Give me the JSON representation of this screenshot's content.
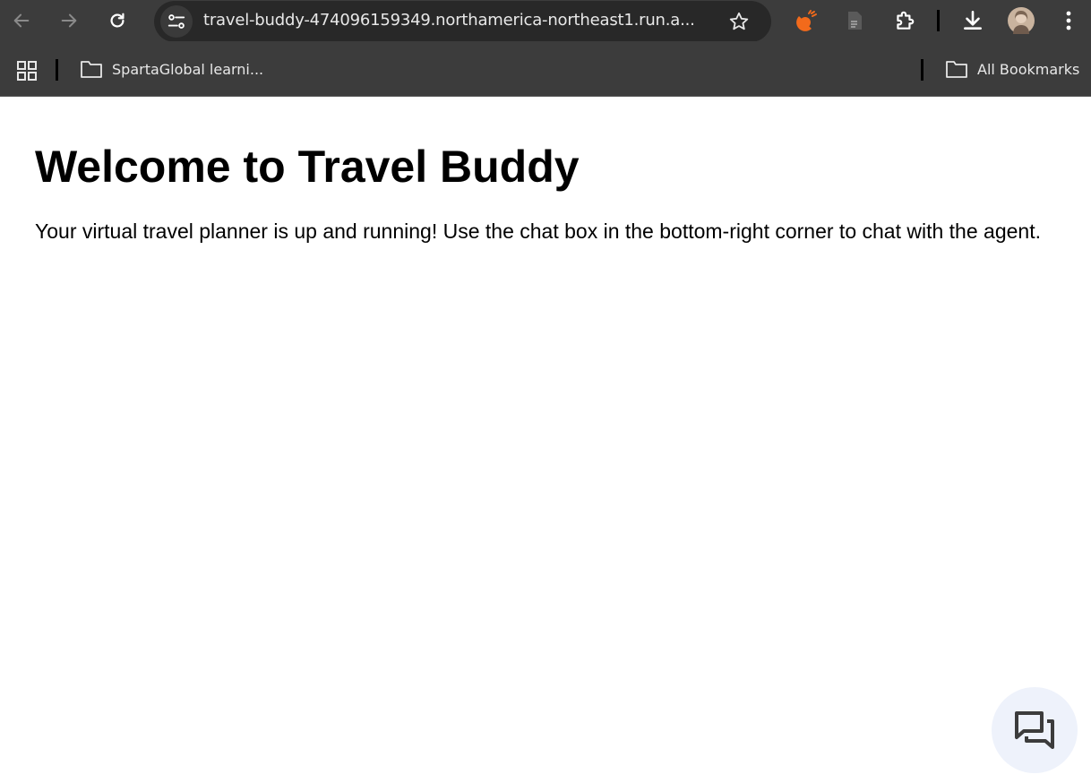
{
  "browser": {
    "url": "travel-buddy-474096159349.northamerica-northeast1.run.a...",
    "toolbar_icons": [
      "back-arrow-icon",
      "forward-arrow-icon",
      "reload-icon",
      "site-info-icon",
      "star-icon",
      "extension-orange-icon",
      "document-icon",
      "puzzle-icon",
      "download-icon",
      "profile-avatar",
      "kebab-menu-icon"
    ],
    "accent_color": "#f26a1b"
  },
  "bookmarks": {
    "folder": "SpartaGlobal learni...",
    "all_bookmarks": "All Bookmarks"
  },
  "page": {
    "title": "Welcome to Travel Buddy",
    "body": "Your virtual travel planner is up and running! Use the chat box in the bottom-right corner to chat with the agent."
  },
  "chat": {
    "icon": "chat-bubbles-icon",
    "background": "#eef2fb"
  }
}
